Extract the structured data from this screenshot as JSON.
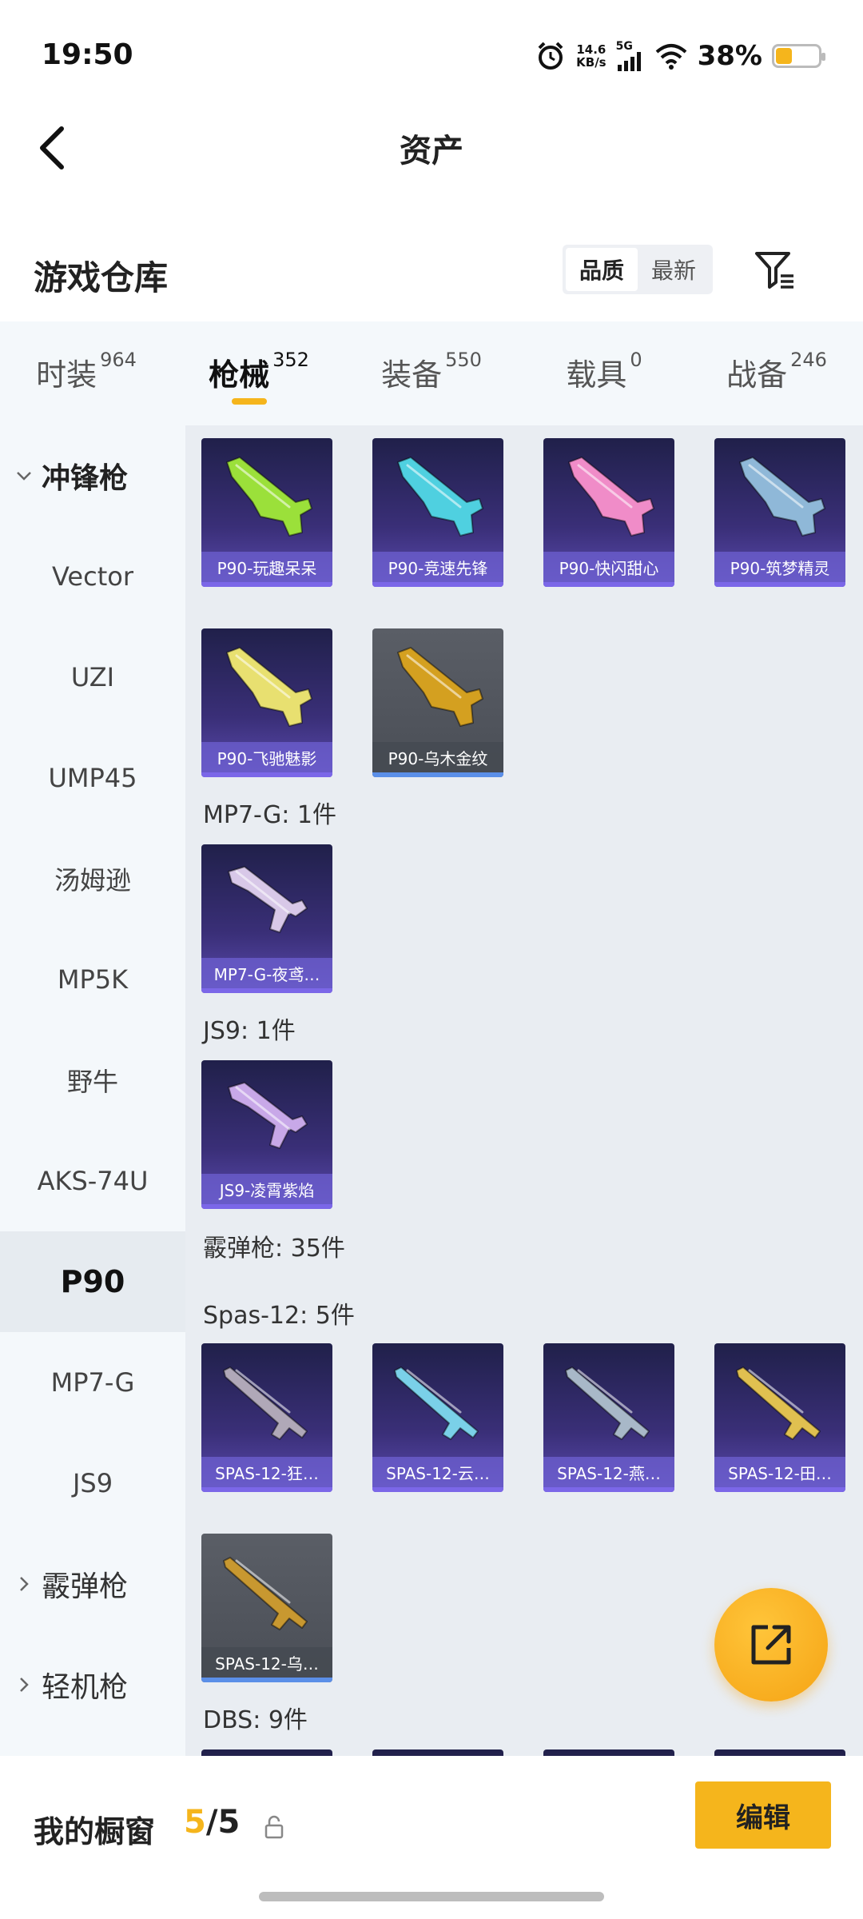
{
  "status_bar": {
    "time": "19:50",
    "net_speed_value": "14.6",
    "net_speed_unit": "KB/s",
    "network": "5G",
    "battery_percent": "38%",
    "battery_level": 0.38,
    "icons": [
      "alarm-icon",
      "signal-icon",
      "wifi-icon",
      "battery-icon"
    ]
  },
  "header": {
    "title": "资产",
    "back_icon": "back-arrow-icon"
  },
  "section": {
    "title": "游戏仓库",
    "sort_options": [
      "品质",
      "最新"
    ],
    "sort_selected": "品质",
    "filter_icon": "filter-icon"
  },
  "tabs": [
    {
      "label": "时装",
      "count": "964"
    },
    {
      "label": "枪械",
      "count": "352",
      "active": true
    },
    {
      "label": "装备",
      "count": "550"
    },
    {
      "label": "载具",
      "count": "0"
    },
    {
      "label": "战备",
      "count": "246"
    }
  ],
  "sidebar": {
    "items": [
      {
        "label": "冲锋枪",
        "type": "group",
        "expanded": true
      },
      {
        "label": "Vector"
      },
      {
        "label": "UZI"
      },
      {
        "label": "UMP45"
      },
      {
        "label": "汤姆逊"
      },
      {
        "label": "MP5K"
      },
      {
        "label": "野牛"
      },
      {
        "label": "AKS-74U"
      },
      {
        "label": "P90",
        "selected": true
      },
      {
        "label": "MP7-G"
      },
      {
        "label": "JS9"
      },
      {
        "label": "霰弹枪",
        "type": "group",
        "expanded": false
      },
      {
        "label": "轻机枪",
        "type": "group",
        "expanded": false
      }
    ]
  },
  "main": {
    "p90_items": [
      {
        "label": "P90-玩趣呆呆",
        "gun_color": "#9be03a"
      },
      {
        "label": "P90-竞速先锋",
        "gun_color": "#4fd0e0"
      },
      {
        "label": "P90-快闪甜心",
        "gun_color": "#f08cc8"
      },
      {
        "label": "P90-筑梦精灵",
        "gun_color": "#8fb8d8"
      },
      {
        "label": "P90-飞驰魅影",
        "gun_color": "#e8e070"
      },
      {
        "label": "P90-乌木金纹",
        "gun_color": "#d4a020",
        "rarity": "grey"
      }
    ],
    "mp7_heading": "MP7-G: 1件",
    "mp7_items": [
      {
        "label": "MP7-G-夜鸢…",
        "gun_color": "#d8c8e8"
      }
    ],
    "js9_heading": "JS9: 1件",
    "js9_items": [
      {
        "label": "JS9-凌霄紫焰",
        "gun_color": "#c8a8e8"
      }
    ],
    "shotgun_heading": "霰弹枪: 35件",
    "spas_heading": "Spas-12: 5件",
    "spas_items": [
      {
        "label": "SPAS-12-狂…",
        "gun_color": "#b0a8b8"
      },
      {
        "label": "SPAS-12-云…",
        "gun_color": "#7ad0e8"
      },
      {
        "label": "SPAS-12-燕…",
        "gun_color": "#a8b8c8"
      },
      {
        "label": "SPAS-12-田…",
        "gun_color": "#e0c050"
      },
      {
        "label": "SPAS-12-乌…",
        "gun_color": "#c89830",
        "rarity": "grey"
      }
    ],
    "dbs_heading": "DBS: 9件"
  },
  "fab": {
    "icon": "share-external-icon"
  },
  "bottom_bar": {
    "showcase_label": "我的橱窗",
    "showcase_current": "5",
    "showcase_total": "/5",
    "lock_icon": "lock-icon",
    "edit_label": "编辑"
  },
  "colors": {
    "accent": "#f5b51c",
    "card_purple": "#3a2f78",
    "panel_bg": "#e9edf2"
  }
}
